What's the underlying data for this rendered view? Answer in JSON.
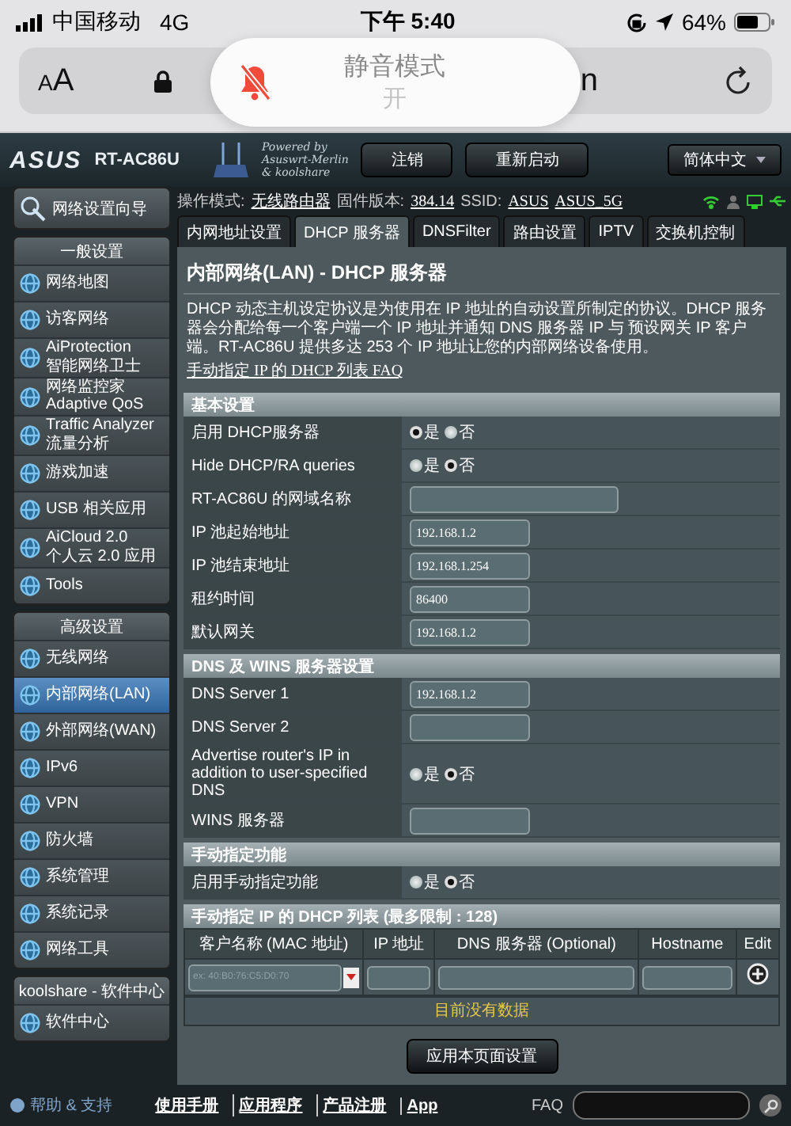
{
  "phone_status": {
    "carrier": "中国移动",
    "network": "4G",
    "time": "下午 5:40",
    "battery": "64%"
  },
  "browser": {
    "text_size_small": "A",
    "text_size_large": "A",
    "url": "n"
  },
  "mute_hud": {
    "title": "静音模式",
    "state": "开"
  },
  "header": {
    "logo": "ASUS",
    "model": "RT-AC86U",
    "powered": [
      "Powered by",
      "Asuswrt-Merlin",
      "& koolshare"
    ],
    "buttons": [
      "注销",
      "重新启动"
    ],
    "language": "简体中文"
  },
  "info": [
    {
      "kind": "label",
      "text": "操作模式:"
    },
    {
      "kind": "link",
      "text": "无线路由器"
    },
    {
      "kind": "label",
      "text": "固件版本:"
    },
    {
      "kind": "link",
      "text": "384.14"
    },
    {
      "kind": "label",
      "text": "SSID:"
    },
    {
      "kind": "link",
      "text": "ASUS"
    },
    {
      "kind": "link",
      "text": "ASUS_5G"
    }
  ],
  "sidebar": {
    "wizard": "网络设置向导",
    "sections": [
      {
        "title": "一般设置",
        "items": [
          {
            "label": "网络地图",
            "selected": false
          },
          {
            "label": "访客网络",
            "selected": false
          },
          {
            "label": "AiProtection",
            "sublabel": "智能网络卫士",
            "selected": false
          },
          {
            "label": "网络监控家 Adaptive QoS",
            "selected": false
          },
          {
            "label": "Traffic Analyzer",
            "sublabel": "流量分析",
            "selected": false
          },
          {
            "label": "游戏加速",
            "selected": false
          },
          {
            "label": "USB 相关应用",
            "selected": false
          },
          {
            "label": "AiCloud 2.0",
            "sublabel": "个人云 2.0 应用",
            "selected": false
          },
          {
            "label": "Tools",
            "selected": false
          }
        ]
      },
      {
        "title": "高级设置",
        "items": [
          {
            "label": "无线网络",
            "selected": false
          },
          {
            "label": "内部网络(LAN)",
            "selected": true
          },
          {
            "label": "外部网络(WAN)",
            "selected": false
          },
          {
            "label": "IPv6",
            "selected": false
          },
          {
            "label": "VPN",
            "selected": false
          },
          {
            "label": "防火墙",
            "selected": false
          },
          {
            "label": "系统管理",
            "selected": false
          },
          {
            "label": "系统记录",
            "selected": false
          },
          {
            "label": "网络工具",
            "selected": false
          }
        ]
      },
      {
        "title": "koolshare - 软件中心",
        "items": [
          {
            "label": "软件中心",
            "selected": false
          }
        ]
      }
    ]
  },
  "main": {
    "tabs": [
      {
        "label": "内网地址设置",
        "selected": false
      },
      {
        "label": "DHCP 服务器",
        "selected": true
      },
      {
        "label": "DNSFilter",
        "selected": false
      },
      {
        "label": "路由设置",
        "selected": false
      },
      {
        "label": "IPTV",
        "selected": false
      },
      {
        "label": "交换机控制",
        "selected": false
      }
    ],
    "title": "内部网络(LAN) - DHCP 服务器",
    "description": "DHCP 动态主机设定协议是为使用在 IP 地址的自动设置所制定的协议。DHCP 服务器会分配给每一个客户端一个 IP 地址并通知 DNS 服务器 IP 与 预设网关 IP 客户端。RT-AC86U 提供多达 253 个 IP 地址让您的内部网络设备使用。",
    "faq_link": "手动指定 IP 的 DHCP 列表 FAQ",
    "sections": [
      {
        "title": "基本设置",
        "rows": [
          {
            "kind": "radio",
            "label": "启用 DHCP服务器",
            "options": [
              {
                "label": "是",
                "selected": true
              },
              {
                "label": "否",
                "selected": false
              }
            ]
          },
          {
            "kind": "radio",
            "label": "Hide DHCP/RA queries",
            "options": [
              {
                "label": "是",
                "selected": false
              },
              {
                "label": "否",
                "selected": true
              }
            ]
          },
          {
            "kind": "input",
            "label": "RT-AC86U 的网域名称",
            "wide": true
          },
          {
            "kind": "input",
            "label": "IP 池起始地址",
            "value": "192.168.1.2",
            "wide": false
          },
          {
            "kind": "input",
            "label": "IP 池结束地址",
            "value": "192.168.1.254",
            "wide": false
          },
          {
            "kind": "input",
            "label": "租约时间",
            "value": "86400",
            "wide": false
          },
          {
            "kind": "input",
            "label": "默认网关",
            "value": "192.168.1.2",
            "wide": false
          }
        ]
      },
      {
        "title": "DNS 及 WINS 服务器设置",
        "rows": [
          {
            "kind": "input",
            "label": "DNS Server 1",
            "value": "192.168.1.2",
            "wide": false
          },
          {
            "kind": "input",
            "label": "DNS Server 2",
            "wide": false
          },
          {
            "kind": "radio",
            "label": "Advertise router's IP in addition to user-specified DNS",
            "options": [
              {
                "label": "是",
                "selected": false
              },
              {
                "label": "否",
                "selected": true
              }
            ]
          },
          {
            "kind": "input",
            "label": "WINS 服务器",
            "wide": false
          }
        ]
      },
      {
        "title": "手动指定功能",
        "rows": [
          {
            "kind": "radio",
            "label": "启用手动指定功能",
            "options": [
              {
                "label": "是",
                "selected": false
              },
              {
                "label": "否",
                "selected": true
              }
            ]
          }
        ]
      }
    ],
    "dhcp_list": {
      "title": "手动指定 IP 的 DHCP 列表 (最多限制 : 128)",
      "columns": [
        "客户名称 (MAC 地址)",
        "IP 地址",
        "DNS 服务器 (Optional)",
        "Hostname",
        "Edit"
      ],
      "placeholder": "ex: 40:B0:76:C5:D0:70",
      "empty_message": "目前没有数据"
    },
    "apply_button": "应用本页面设置"
  },
  "footer": {
    "help": "帮助 & 支持",
    "links": [
      "使用手册",
      "应用程序",
      "产品注册",
      "App"
    ],
    "faq": "FAQ"
  }
}
